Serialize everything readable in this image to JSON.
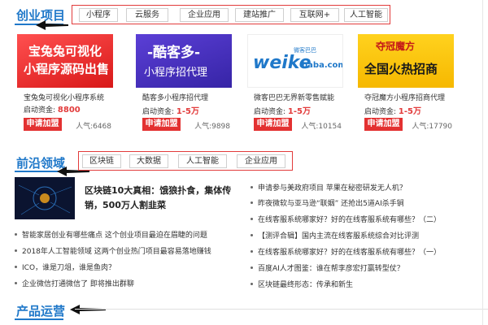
{
  "sections": {
    "startup": {
      "title": "创业项目",
      "tags": [
        "小程序",
        "云服务",
        "企业应用",
        "建站推广",
        "互联网+",
        "人工智能"
      ]
    },
    "frontier": {
      "title": "前沿领域",
      "tags": [
        "区块链",
        "大数据",
        "人工智能",
        "企业应用"
      ]
    },
    "product": {
      "title": "产品运营"
    }
  },
  "cards": [
    {
      "banner_line1": "宝兔兔可视化",
      "banner_line2": "小程序源码出售",
      "title": "宝兔兔可视化小程序系统",
      "funds_label": "启动资金:",
      "funds_value": "8800",
      "apply": "申请加盟",
      "popularity": "人气:6468"
    },
    {
      "banner_line1": "-酷客多-",
      "banner_line2": "小程序招代理",
      "title": "酷客多小程序招代理",
      "funds_label": "启动资金:",
      "funds_value": "1-5万",
      "apply": "申请加盟",
      "popularity": "人气:9898"
    },
    {
      "banner_logo_small": "微客巴巴",
      "banner_logo": "weike",
      "banner_logo_suffix": "baba.com",
      "title": "微客巴巴无界新零售赋能",
      "funds_label": "启动资金:",
      "funds_value": "1-5万",
      "apply": "申请加盟",
      "popularity": "人气:10154"
    },
    {
      "banner_brand": "夺冠魔方",
      "banner_slogan": "全国火热招商",
      "title": "夺冠魔方小程序招商代理",
      "funds_label": "启动资金:",
      "funds_value": "1-5万",
      "apply": "申请加盟",
      "popularity": "人气:17790"
    }
  ],
  "featured": {
    "title": "区块链10大真相：饿狼扑食，集体传销，500万人割韭菜"
  },
  "news_left": [
    "智能家居创业有哪些痛点 这个创业项目最迫在眉睫的问题",
    "2018年人工智能领域 这两个创业热门项目最容易落地赚钱",
    "ICO，谁是刀俎，谁是鱼肉？",
    "企业微信打通微信了 即将推出群聊"
  ],
  "news_right": [
    "申请参与美政府项目 苹果在秘密研发无人机？",
    "昨夜微软与亚马逊“联姻” 还抢出5道AI杀手锏",
    "在线客服系统哪家好？好的在线客服系统有哪些？（二）",
    "【测评合辑】国内主流在线客服系统综合对比评测",
    "在线客服系统哪家好？好的在线客服系统有哪些？（一）",
    "百度AI人才图鉴：谁在帮李彦宏打赢转型仗？",
    "区块链最终形态：传承和新生"
  ],
  "colors": {
    "brand_blue": "#1f78c9",
    "accent_red": "#e33131",
    "border_red": "#e23b3b"
  }
}
